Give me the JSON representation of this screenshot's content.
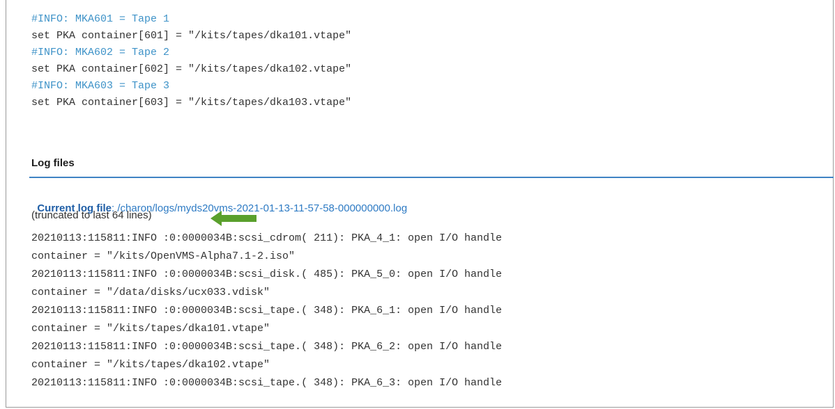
{
  "config_lines": [
    {
      "text": "#INFO: MKA601 = Tape 1",
      "kind": "comment"
    },
    {
      "text": "set PKA container[601] = \"/kits/tapes/dka101.vtape\"",
      "kind": "code"
    },
    {
      "text": "#INFO: MKA602 = Tape 2",
      "kind": "comment"
    },
    {
      "text": "set PKA container[602] = \"/kits/tapes/dka102.vtape\"",
      "kind": "code"
    },
    {
      "text": "#INFO: MKA603 = Tape 3",
      "kind": "comment"
    },
    {
      "text": "set PKA container[603] = \"/kits/tapes/dka103.vtape\"",
      "kind": "code"
    }
  ],
  "log_section": {
    "title": "Log files",
    "current_label": "Current log file",
    "current_path": ": /charon/logs/myds20vms-2021-01-13-11-57-58-000000000.log",
    "truncated_note": "(truncated to last 64 lines)",
    "arrow_icon": "arrow-left-icon",
    "arrow_color": "#5aa02c"
  },
  "log_lines": [
    "20210113:115811:INFO :0:0000034B:scsi_cdrom( 211): PKA_4_1: open I/O handle",
    "container = \"/kits/OpenVMS-Alpha7.1-2.iso\"",
    "20210113:115811:INFO :0:0000034B:scsi_disk.( 485): PKA_5_0: open I/O handle",
    "container = \"/data/disks/ucx033.vdisk\"",
    "20210113:115811:INFO :0:0000034B:scsi_tape.( 348): PKA_6_1: open I/O handle",
    "container = \"/kits/tapes/dka101.vtape\"",
    "20210113:115811:INFO :0:0000034B:scsi_tape.( 348): PKA_6_2: open I/O handle",
    "container = \"/kits/tapes/dka102.vtape\"",
    "20210113:115811:INFO :0:0000034B:scsi_tape.( 348): PKA_6_3: open I/O handle"
  ]
}
